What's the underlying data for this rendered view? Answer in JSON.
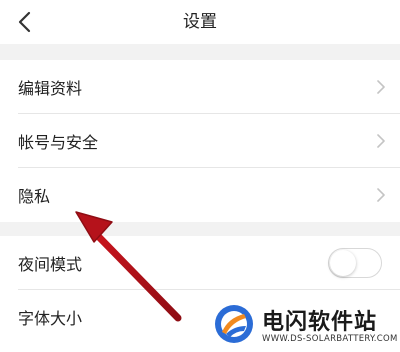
{
  "header": {
    "title": "设置"
  },
  "groups": [
    {
      "items": [
        {
          "label": "编辑资料",
          "type": "link"
        },
        {
          "label": "帐号与安全",
          "type": "link"
        },
        {
          "label": "隐私",
          "type": "link"
        }
      ]
    },
    {
      "items": [
        {
          "label": "夜间模式",
          "type": "toggle",
          "on": false
        },
        {
          "label": "字体大小",
          "type": "link"
        }
      ]
    }
  ],
  "annotation": {
    "color": "#b5121b",
    "target": "隐私"
  },
  "watermark": {
    "title": "电闪软件站",
    "url": "WWW.DS-SOLARBATTERY.COM",
    "logo_colors": [
      "#2b6cd6",
      "#f28a1e"
    ]
  }
}
